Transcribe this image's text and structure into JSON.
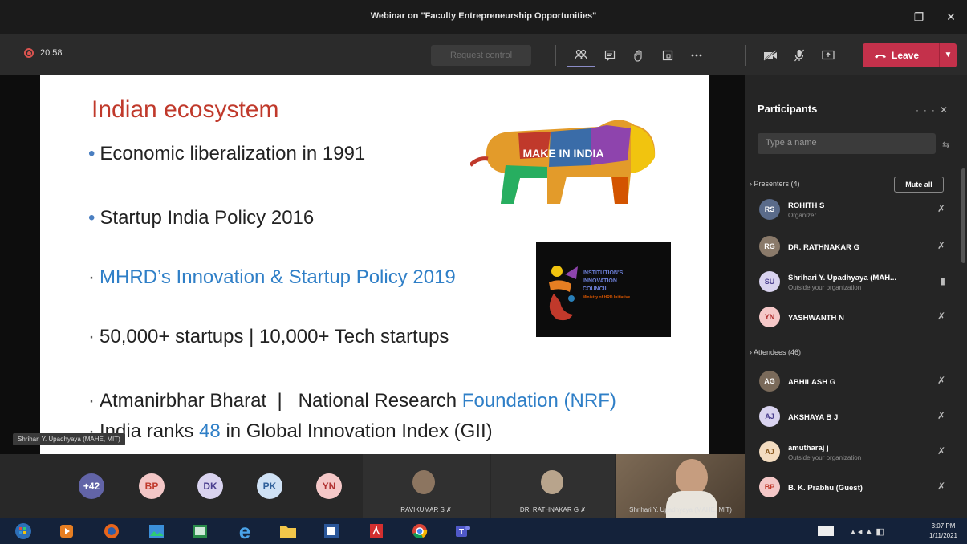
{
  "window": {
    "title": "Webinar on \"Faculty Entrepreneurship Opportunities\"",
    "minimize": "‒",
    "maximize": "❐",
    "close": "✕"
  },
  "toolbar": {
    "timer": "20:58",
    "request_control": "Request control",
    "icons": [
      "people-icon",
      "chat-icon",
      "raise-hand-icon",
      "rooms-icon",
      "more-icon",
      "camera-off-icon",
      "mic-off-icon",
      "share-icon"
    ],
    "leave_label": "Leave"
  },
  "slide": {
    "title": "Indian ecosystem",
    "b1": "Economic liberalization in 1991",
    "b2": "Startup India Policy 2016",
    "b3": "MHRD’s Innovation & Startup Policy 2019",
    "b4": "50,000+ startups | 10,000+ Tech startups",
    "b5_pre": "Atmanirbhar Bharat  |   National Research ",
    "b5_hl": "Foundation (NRF)",
    "b6_pre": "India ranks ",
    "b6_hl": "48",
    "b6_post": " in Global Innovation Index (GII)",
    "logo1_text": "MAKE IN INDIA",
    "logo2_lines": [
      "INSTITUTION'S",
      "INNOVATION",
      "COUNCIL"
    ],
    "logo2_sub": "Ministry of HRD Initiative"
  },
  "presenter_label": "Shrihari Y. Upadhyaya (MAHE, MIT)",
  "strip": {
    "overflow": "+42",
    "avatars": [
      {
        "initials": "BP",
        "bg": "#f3c7c7",
        "fg": "#c0392b"
      },
      {
        "initials": "DK",
        "bg": "#d9d3ef",
        "fg": "#4b3f8f"
      },
      {
        "initials": "PK",
        "bg": "#cfe1f5",
        "fg": "#2f5f9a"
      },
      {
        "initials": "YN",
        "bg": "#f5c8c8",
        "fg": "#b03030"
      }
    ],
    "tiles": [
      "RAVIKUMAR S",
      "DR. RATHNAKAR G",
      "Shrihari Y. Upadhyaya (MAHE, MIT)"
    ]
  },
  "panel": {
    "title": "Participants",
    "search_placeholder": "Type a name",
    "mute_all": "Mute all",
    "presenters_label": "Presenters (4)",
    "attendees_label": "Attendees (46)",
    "presenters": [
      {
        "name": "ROHITH S",
        "sub": "Organizer",
        "initials": "RS",
        "bg": "#5a6b8a",
        "mic": "mic-off-icon"
      },
      {
        "name": "DR. RATHNAKAR G",
        "sub": "",
        "initials": "RG",
        "bg": "#8a7a6a",
        "mic": "mic-off-icon"
      },
      {
        "name": "Shrihari Y. Upadhyaya (MAH...",
        "sub": "Outside your organization",
        "initials": "SU",
        "bg": "#d9d3ef",
        "mic": "mic-on-icon"
      },
      {
        "name": "YASHWANTH N",
        "sub": "",
        "initials": "YN",
        "bg": "#f5c8c8",
        "mic": "mic-off-icon"
      }
    ],
    "attendees": [
      {
        "name": "ABHILASH G",
        "sub": "",
        "initials": "AG",
        "bg": "#7a6a5a",
        "mic": "mic-off-icon"
      },
      {
        "name": "AKSHAYA B J",
        "sub": "",
        "initials": "AJ",
        "bg": "#d9d3ef",
        "mic": "mic-off-icon"
      },
      {
        "name": "amutharaj j",
        "sub": "Outside your organization",
        "initials": "AJ",
        "bg": "#f3dcc0",
        "mic": "mic-off-icon"
      },
      {
        "name": "B. K. Prabhu (Guest)",
        "sub": "",
        "initials": "BP",
        "bg": "#f3c7c7",
        "mic": "mic-off-icon"
      }
    ]
  },
  "taskbar": {
    "time": "3:07 PM",
    "date": "1/11/2021"
  }
}
